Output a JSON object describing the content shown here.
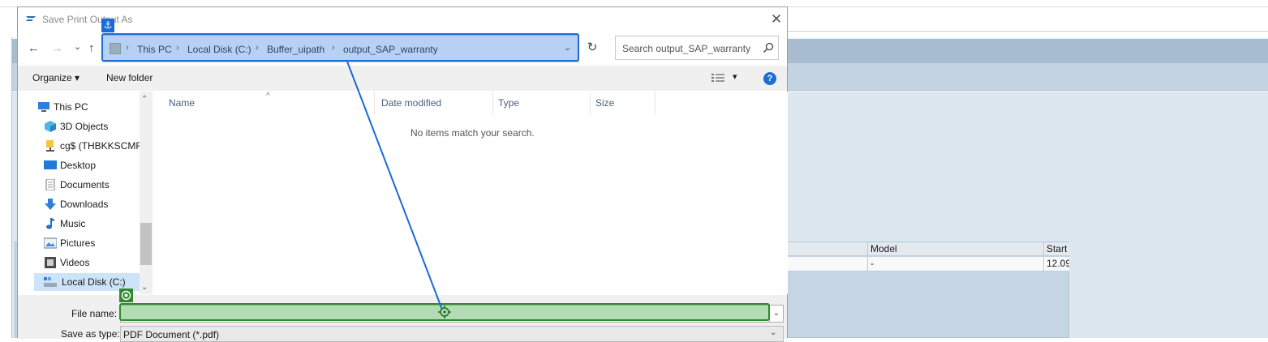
{
  "dialog": {
    "title": "Save Print Output As",
    "close": "✕"
  },
  "nav": {
    "back": "←",
    "forward": "→",
    "recent": "⌄",
    "up": "↑",
    "breadcrumbs": [
      "This PC",
      "Local Disk (C:)",
      "Buffer_uipath",
      "output_SAP_warranty"
    ],
    "separator": "›",
    "dropdown": "⌄",
    "refresh": "↻",
    "search_placeholder": "Search output_SAP_warranty"
  },
  "toolbar": {
    "organize": "Organize ▾",
    "new_folder": "New folder",
    "view_dropdown": "▾",
    "help": "?"
  },
  "tree": {
    "items": [
      {
        "label": "This PC",
        "icon": "computer-icon"
      },
      {
        "label": "3D Objects",
        "icon": "cube-icon"
      },
      {
        "label": "cg$ (THBKKSCMR",
        "icon": "network-drive-icon"
      },
      {
        "label": "Desktop",
        "icon": "desktop-icon"
      },
      {
        "label": "Documents",
        "icon": "document-icon"
      },
      {
        "label": "Downloads",
        "icon": "download-icon"
      },
      {
        "label": "Music",
        "icon": "music-icon"
      },
      {
        "label": "Pictures",
        "icon": "pictures-icon"
      },
      {
        "label": "Videos",
        "icon": "video-icon"
      },
      {
        "label": "Local Disk (C:)",
        "icon": "drive-icon"
      }
    ]
  },
  "filelist": {
    "columns": [
      "Name",
      "Date modified",
      "Type",
      "Size"
    ],
    "empty_message": "No items match your search."
  },
  "bottom": {
    "file_name_label": "File name:",
    "file_name_value": "",
    "save_as_type_label": "Save as type:",
    "save_as_type_value": "PDF Document (*.pdf)",
    "dropdown": "⌄"
  },
  "background": {
    "grid_headers": [
      "Model",
      "Start"
    ],
    "grid_row": [
      "-",
      "12.09"
    ]
  },
  "annotations": {
    "anchor_badge": "⚓"
  },
  "colors": {
    "annotation_blue": "#1a6bd6",
    "annotation_green": "#2e8b2e",
    "sap_header": "#a7bccf"
  }
}
